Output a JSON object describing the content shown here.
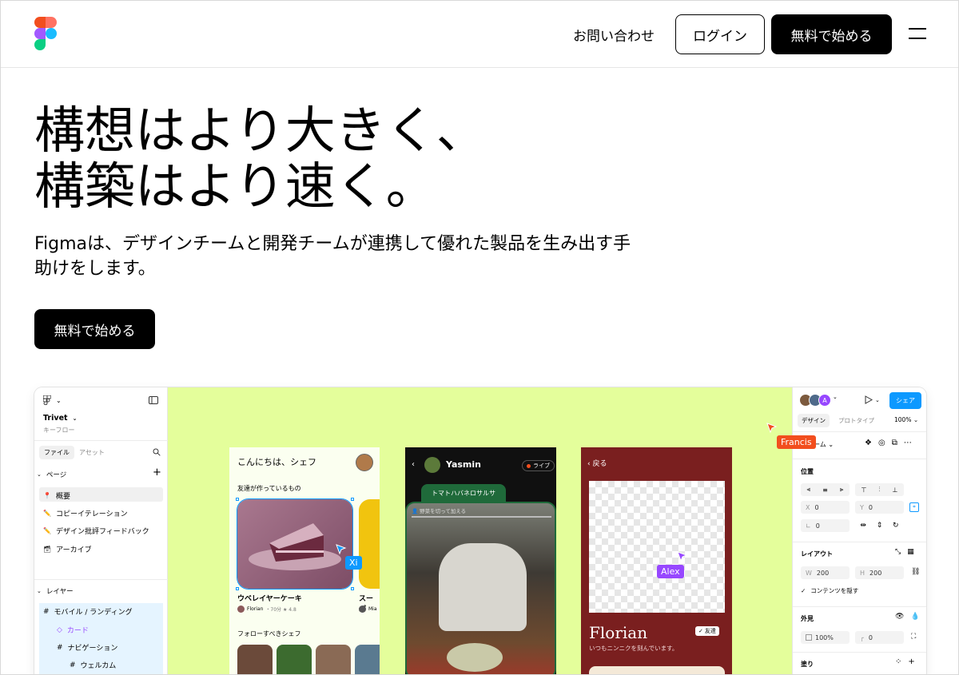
{
  "header": {
    "contact": "お問い合わせ",
    "login": "ログイン",
    "start": "無料で始める"
  },
  "hero": {
    "title_line1": "構想はより大きく、",
    "title_line2": "構築はより速く。",
    "subtitle": "Figmaは、デザインチームと開発チームが連携して優れた製品を生み出す手助けをします。",
    "cta": "無料で始める"
  },
  "app": {
    "left": {
      "file_name": "Trivet",
      "file_sub": "キーフロー",
      "tab_file": "ファイル",
      "tab_assets": "アセット",
      "pages_header": "ページ",
      "pages": [
        "概要",
        "コピーイテレーション",
        "デザイン批評フィードバック",
        "アーカイブ"
      ],
      "layers_header": "レイヤー",
      "layers": [
        "モバイル / ランディング",
        "カード",
        "ナビゲーション",
        "ウェルカム"
      ]
    },
    "canvas": {
      "screen1": {
        "greeting": "こんにちは、シェフ",
        "section1": "友達が作っているもの",
        "dish1": "ウベレイヤーケーキ",
        "dish2": "スーパ",
        "author1": "Florian",
        "meta1": "・70分 ★ 4.8",
        "author2": "Mia",
        "section2": "フォローすべきシェフ"
      },
      "screen2": {
        "name": "Yasmin",
        "live": "ライブ",
        "recipe": "トマトハバネロサルサ",
        "step": "野菜を切って加える"
      },
      "screen3": {
        "back": "戻る",
        "name": "Florian",
        "friend": "友達",
        "desc": "いつもニンニクを刻んでいます。"
      },
      "cursor_xi": "Xi",
      "cursor_alex": "Alex",
      "cursor_francis": "Francis"
    },
    "right": {
      "avatar_a": "A",
      "share": "シェア",
      "tab_design": "デザイン",
      "tab_proto": "プロトタイプ",
      "zoom": "100%",
      "frame_label": "フレーム",
      "position": "位置",
      "x": "0",
      "y": "0",
      "rotation": "0",
      "layout": "レイアウト",
      "w": "200",
      "h": "200",
      "clip": "コンテンツを隠す",
      "appearance": "外見",
      "opacity": "100%",
      "radius": "0",
      "fill": "塗り"
    }
  },
  "colors": {
    "canvas": "#e4fe9b",
    "share_blue": "#0d99ff",
    "francis": "#f24e1e",
    "alex": "#9747ff",
    "xi": "#0d99ff",
    "screen3_bg": "#7a1f1f"
  }
}
